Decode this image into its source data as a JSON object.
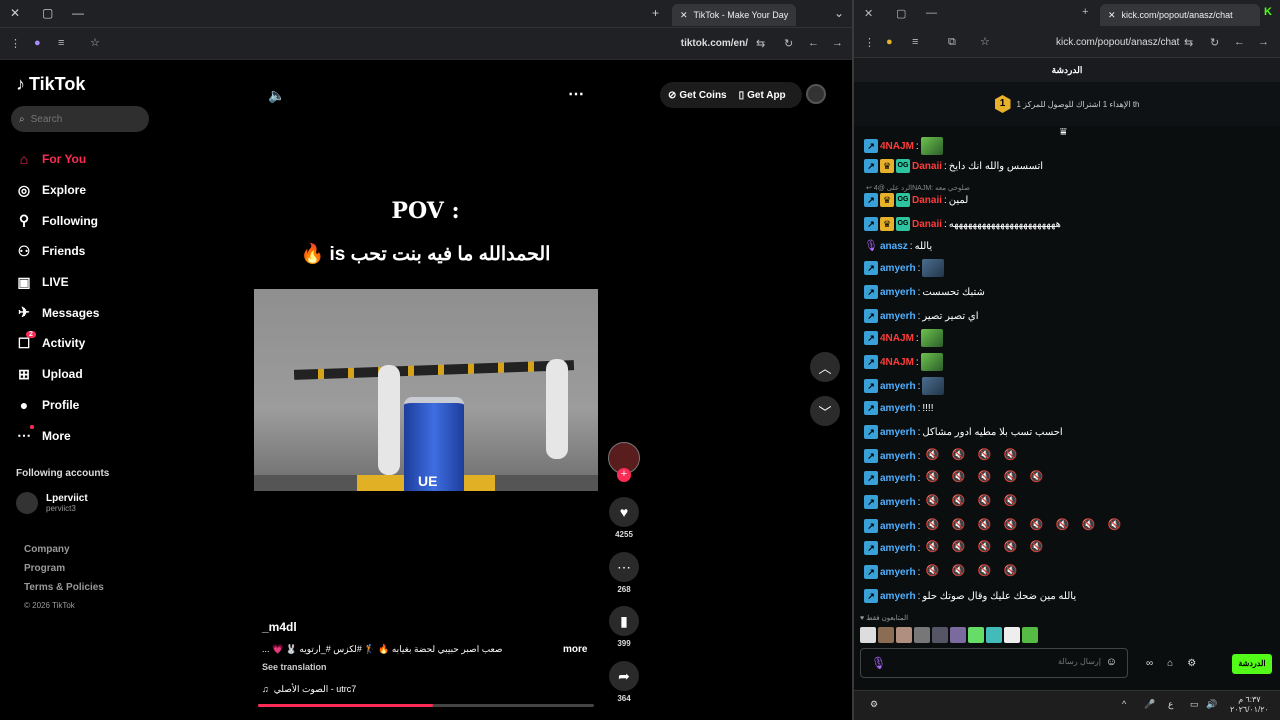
{
  "left_browser": {
    "tab_title": "TikTok - Make Your Day",
    "url": "tiktok.com/en/"
  },
  "right_browser": {
    "tab_title": "kick.com/popout/anasz/chat",
    "url": "kick.com/popout/anasz/chat"
  },
  "tiktok": {
    "logo": "TikTok",
    "search_placeholder": "Search",
    "nav": [
      {
        "label": "For You",
        "icon": "home-icon"
      },
      {
        "label": "Explore",
        "icon": "compass-icon"
      },
      {
        "label": "Following",
        "icon": "following-icon"
      },
      {
        "label": "Friends",
        "icon": "friends-icon"
      },
      {
        "label": "LIVE",
        "icon": "live-icon"
      },
      {
        "label": "Messages",
        "icon": "messages-icon"
      },
      {
        "label": "Activity",
        "icon": "activity-icon"
      },
      {
        "label": "Upload",
        "icon": "upload-icon"
      },
      {
        "label": "Profile",
        "icon": "profile-icon"
      },
      {
        "label": "More",
        "icon": "more-icon"
      }
    ],
    "activity_badge": "2",
    "following_title": "Following accounts",
    "following": {
      "name": "Lperviict",
      "handle": "perviict3"
    },
    "footer": {
      "company": "Company",
      "program": "Program",
      "terms": "Terms & Policies",
      "copyright": "© 2026 TikTok"
    },
    "get_coins": "Get Coins",
    "get_app": "Get App",
    "video": {
      "pov": "POV :",
      "caption": "الحمدالله ما فيه بنت تحب is",
      "can_text": "UE",
      "username": "_m4dl",
      "description": "صعب اصبر حبيبي لحضة بغيابه 🔥 🏌 #لكزس #_ارتويه 🐰 💗 ...",
      "more": "more",
      "see_translation": "See translation",
      "sound": "الصوت الأصلي - utrc7",
      "progress": 0.52
    },
    "actions": {
      "likes": "4255",
      "comments": "268",
      "saves": "399",
      "shares": "364"
    }
  },
  "kick": {
    "header": "الدردشة",
    "goal_number": "1",
    "goal_text": "الإهداء 1 اشتراك للوصول للمركز 1 th",
    "reply_text": "↩ الرد على @4NAJM: صلوحي معه",
    "messages": [
      {
        "user": "4NAJM",
        "color": "#ff3b3b",
        "badges": [
          "bdg"
        ],
        "text": "",
        "emotes": 1
      },
      {
        "user": "Danaii",
        "color": "#ff3b3b",
        "badges": [
          "bdg",
          "crown",
          "og"
        ],
        "text": "اتسسس والله انك دايخ",
        "emotes": 0
      },
      {
        "user": "Danaii",
        "color": "#ff3b3b",
        "badges": [
          "bdg",
          "crown",
          "og"
        ],
        "text": "لمين",
        "emotes": 0
      },
      {
        "user": "Danaii",
        "color": "#ff3b3b",
        "badges": [
          "bdg",
          "crown",
          "og"
        ],
        "text": "هههههههههههههههههههههههه",
        "emotes": 0
      },
      {
        "user": "anasz",
        "color": "#4fb0ff",
        "badges": [
          "mic"
        ],
        "text": "يالله",
        "emotes": 0
      },
      {
        "user": "amyerh",
        "color": "#4fb0ff",
        "badges": [
          "bdg"
        ],
        "text": "",
        "emotes": 1
      },
      {
        "user": "amyerh",
        "color": "#4fb0ff",
        "badges": [
          "bdg"
        ],
        "text": "شتبك تحسست",
        "emotes": 0
      },
      {
        "user": "amyerh",
        "color": "#4fb0ff",
        "badges": [
          "bdg"
        ],
        "text": "اي تصير تصير",
        "emotes": 0
      },
      {
        "user": "4NAJM",
        "color": "#ff3b3b",
        "badges": [
          "bdg"
        ],
        "text": "",
        "emotes": 1
      },
      {
        "user": "4NAJM",
        "color": "#ff3b3b",
        "badges": [
          "bdg"
        ],
        "text": "",
        "emotes": 1
      },
      {
        "user": "amyerh",
        "color": "#4fb0ff",
        "badges": [
          "bdg"
        ],
        "text": "",
        "emotes": 1
      },
      {
        "user": "amyerh",
        "color": "#4fb0ff",
        "badges": [
          "bdg"
        ],
        "text": "!!!!",
        "emotes": 0
      },
      {
        "user": "amyerh",
        "color": "#4fb0ff",
        "badges": [
          "bdg"
        ],
        "text": "احسب تسب بلا مطيه ادور مشاكل",
        "emotes": 0
      },
      {
        "user": "amyerh",
        "color": "#4fb0ff",
        "badges": [
          "bdg"
        ],
        "text": "",
        "mutes": 4
      },
      {
        "user": "amyerh",
        "color": "#4fb0ff",
        "badges": [
          "bdg"
        ],
        "text": "",
        "mutes": 5
      },
      {
        "user": "amyerh",
        "color": "#4fb0ff",
        "badges": [
          "bdg"
        ],
        "text": "",
        "mutes": 4
      },
      {
        "user": "amyerh",
        "color": "#4fb0ff",
        "badges": [
          "bdg"
        ],
        "text": "",
        "mutes": 8
      },
      {
        "user": "amyerh",
        "color": "#4fb0ff",
        "badges": [
          "bdg"
        ],
        "text": "",
        "mutes": 5
      },
      {
        "user": "amyerh",
        "color": "#4fb0ff",
        "badges": [
          "bdg"
        ],
        "text": "",
        "mutes": 4
      },
      {
        "user": "amyerh",
        "color": "#4fb0ff",
        "badges": [
          "bdg"
        ],
        "text": "يالله مين ضحك عليك وقال صوتك حلو",
        "emotes": 0
      }
    ],
    "pinned_label": "المتابعون فقط",
    "input_placeholder": "إرسال رسالة",
    "chat_button": "الدردشة"
  },
  "taskbar": {
    "time": "٦:٣٧ م",
    "date": "٢٠٢٦/٠١/٢٠"
  }
}
